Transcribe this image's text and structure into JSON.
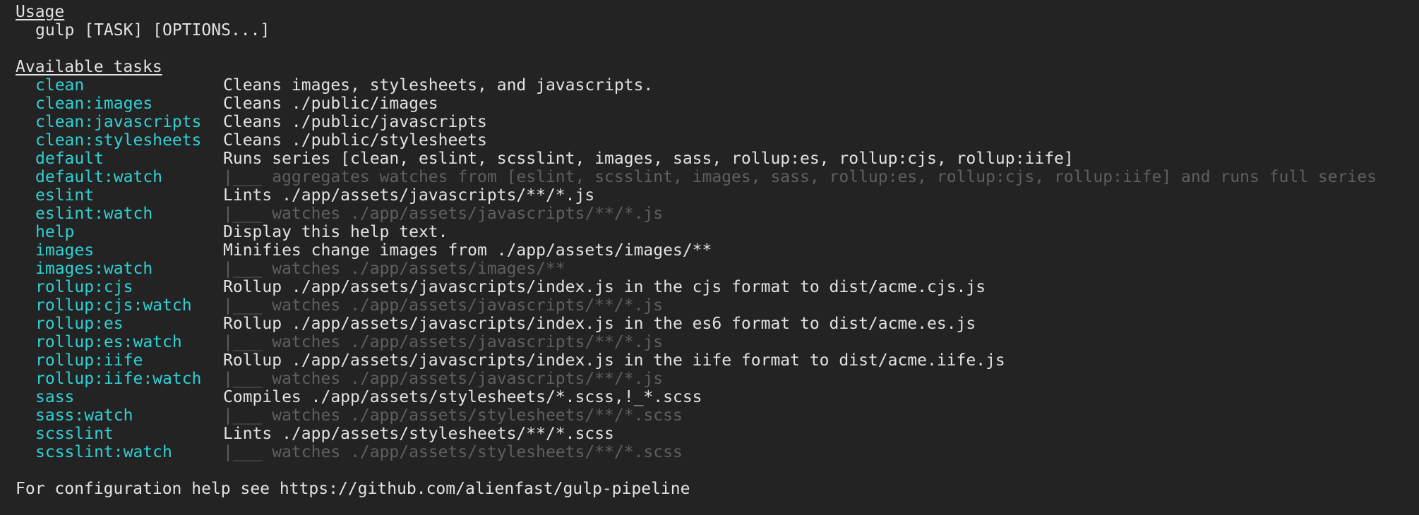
{
  "usage": {
    "heading": "Usage",
    "command": "gulp [TASK] [OPTIONS...]"
  },
  "tasks_section": {
    "heading": "Available tasks",
    "tasks": [
      {
        "name": "clean",
        "description": "Cleans images, stylesheets, and javascripts.",
        "dim": false
      },
      {
        "name": "clean:images",
        "description": "Cleans ./public/images",
        "dim": false
      },
      {
        "name": "clean:javascripts",
        "description": "Cleans ./public/javascripts",
        "dim": false
      },
      {
        "name": "clean:stylesheets",
        "description": "Cleans ./public/stylesheets",
        "dim": false
      },
      {
        "name": "default",
        "description": "Runs series [clean, eslint, scsslint, images, sass, rollup:es, rollup:cjs, rollup:iife]",
        "dim": false
      },
      {
        "name": "default:watch",
        "description": "|___ aggregates watches from [eslint, scsslint, images, sass, rollup:es, rollup:cjs, rollup:iife] and runs full series",
        "dim": true
      },
      {
        "name": "eslint",
        "description": "Lints ./app/assets/javascripts/**/*.js",
        "dim": false
      },
      {
        "name": "eslint:watch",
        "description": "|___ watches ./app/assets/javascripts/**/*.js",
        "dim": true
      },
      {
        "name": "help",
        "description": "Display this help text.",
        "dim": false
      },
      {
        "name": "images",
        "description": "Minifies change images from ./app/assets/images/**",
        "dim": false
      },
      {
        "name": "images:watch",
        "description": "|___ watches ./app/assets/images/**",
        "dim": true
      },
      {
        "name": "rollup:cjs",
        "description": "Rollup ./app/assets/javascripts/index.js in the cjs format to dist/acme.cjs.js",
        "dim": false
      },
      {
        "name": "rollup:cjs:watch",
        "description": "|___ watches ./app/assets/javascripts/**/*.js",
        "dim": true
      },
      {
        "name": "rollup:es",
        "description": "Rollup ./app/assets/javascripts/index.js in the es6 format to dist/acme.es.js",
        "dim": false
      },
      {
        "name": "rollup:es:watch",
        "description": "|___ watches ./app/assets/javascripts/**/*.js",
        "dim": true
      },
      {
        "name": "rollup:iife",
        "description": "Rollup ./app/assets/javascripts/index.js in the iife format to dist/acme.iife.js",
        "dim": false
      },
      {
        "name": "rollup:iife:watch",
        "description": "|___ watches ./app/assets/javascripts/**/*.js",
        "dim": true
      },
      {
        "name": "sass",
        "description": "Compiles ./app/assets/stylesheets/*.scss,!_*.scss",
        "dim": false
      },
      {
        "name": "sass:watch",
        "description": "|___ watches ./app/assets/stylesheets/**/*.scss",
        "dim": true
      },
      {
        "name": "scsslint",
        "description": "Lints ./app/assets/stylesheets/**/*.scss",
        "dim": false
      },
      {
        "name": "scsslint:watch",
        "description": "|___ watches ./app/assets/stylesheets/**/*.scss",
        "dim": true
      }
    ]
  },
  "footer": {
    "text": "For configuration help see https://github.com/alienfast/gulp-pipeline"
  },
  "colors": {
    "background": "#232323",
    "text": "#e2e2e2",
    "task_name": "#2fd1d4",
    "dim_text": "#5f5f5f"
  }
}
